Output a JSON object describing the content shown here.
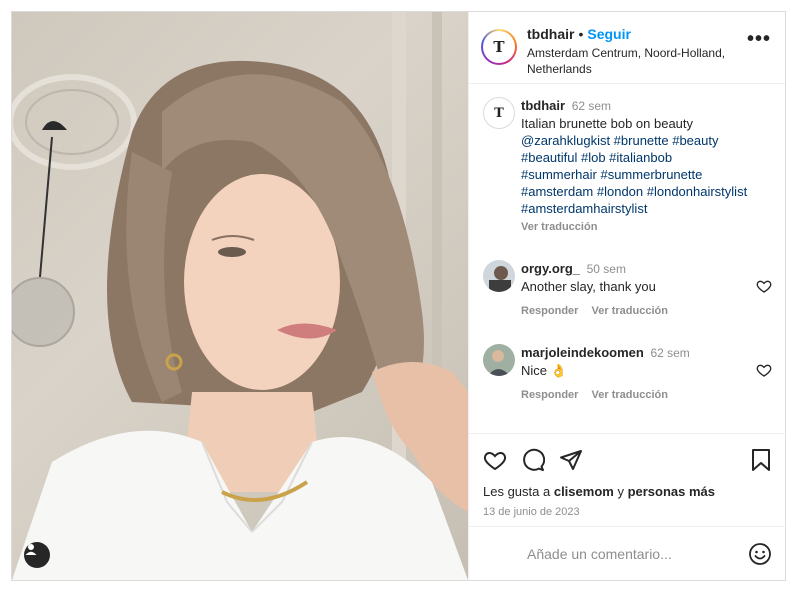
{
  "post": {
    "username": "tbdhair",
    "follow_label": "Seguir",
    "location": "Amsterdam Centrum, Noord-Holland, Netherlands",
    "avatar_letter": "T"
  },
  "caption": {
    "username": "tbdhair",
    "time": "62 sem",
    "text": "Italian brunette bob on beauty",
    "tags": "@zarahklugkist #brunette #beauty #beautiful #lob #italianbob #summerhair #summerbrunette #amsterdam #london #londonhairstylist #amsterdamhairstylist",
    "translate": "Ver traducción"
  },
  "comments": [
    {
      "username": "orgy.org_",
      "time": "50 sem",
      "text": "Another slay, thank you",
      "reply": "Responder",
      "translate": "Ver traducción"
    },
    {
      "username": "marjoleindekoomen",
      "time": "62 sem",
      "text": "Nice 👌",
      "reply": "Responder",
      "translate": "Ver traducción"
    }
  ],
  "likes": {
    "prefix": "Les gusta a",
    "user": "clisemom",
    "middle": "y",
    "suffix": "personas más"
  },
  "date": "13 de junio de 2023",
  "comment_input": {
    "placeholder": "Añade un comentario..."
  },
  "icons": [
    "heart-icon",
    "comment-icon",
    "share-icon",
    "bookmark-icon",
    "more-icon",
    "user-tag-icon",
    "emoji-icon"
  ],
  "colors": {
    "accent": "#0095f6",
    "hashtag": "#00376b",
    "muted": "#8e8e8e"
  }
}
